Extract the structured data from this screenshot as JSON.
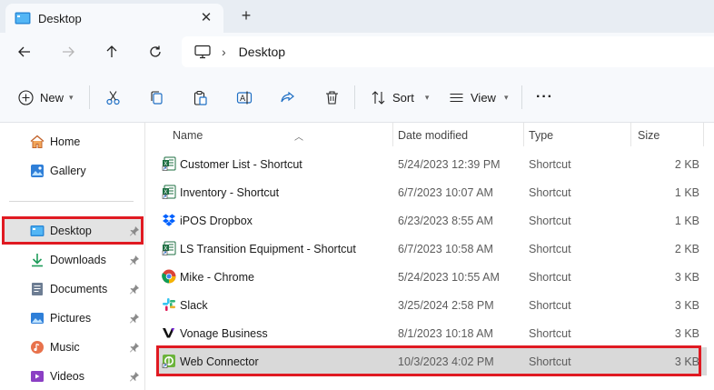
{
  "tab": {
    "title": "Desktop",
    "close_glyph": "✕",
    "new_glyph": "+"
  },
  "address": {
    "crumb": "Desktop",
    "separator": "›"
  },
  "toolbar": {
    "new_label": "New",
    "sort_label": "Sort",
    "view_label": "View",
    "more_glyph": "···"
  },
  "sidebar": {
    "items": [
      {
        "label": "Home",
        "icon": "home-icon"
      },
      {
        "label": "Gallery",
        "icon": "gallery-icon"
      },
      {
        "label": "Desktop",
        "icon": "desktop-icon",
        "pinned": true
      },
      {
        "label": "Downloads",
        "icon": "downloads-icon",
        "pinned": true
      },
      {
        "label": "Documents",
        "icon": "documents-icon",
        "pinned": true
      },
      {
        "label": "Pictures",
        "icon": "pictures-icon",
        "pinned": true
      },
      {
        "label": "Music",
        "icon": "music-icon",
        "pinned": true
      },
      {
        "label": "Videos",
        "icon": "videos-icon",
        "pinned": true
      }
    ]
  },
  "columns": {
    "name": "Name",
    "date": "Date modified",
    "type": "Type",
    "size": "Size"
  },
  "files": [
    {
      "name": "Customer List - Shortcut",
      "date": "5/24/2023 12:39 PM",
      "type": "Shortcut",
      "size": "2 KB",
      "icon": "excel-shortcut-icon"
    },
    {
      "name": "Inventory - Shortcut",
      "date": "6/7/2023 10:07 AM",
      "type": "Shortcut",
      "size": "1 KB",
      "icon": "excel-shortcut-icon"
    },
    {
      "name": "iPOS Dropbox",
      "date": "6/23/2023 8:55 AM",
      "type": "Shortcut",
      "size": "1 KB",
      "icon": "dropbox-icon"
    },
    {
      "name": "LS Transition Equipment - Shortcut",
      "date": "6/7/2023 10:58 AM",
      "type": "Shortcut",
      "size": "2 KB",
      "icon": "excel-shortcut-icon"
    },
    {
      "name": "Mike - Chrome",
      "date": "5/24/2023 10:55 AM",
      "type": "Shortcut",
      "size": "3 KB",
      "icon": "chrome-icon"
    },
    {
      "name": "Slack",
      "date": "3/25/2024 2:58 PM",
      "type": "Shortcut",
      "size": "3 KB",
      "icon": "slack-icon"
    },
    {
      "name": "Vonage Business",
      "date": "8/1/2023 10:18 AM",
      "type": "Shortcut",
      "size": "3 KB",
      "icon": "vonage-icon"
    },
    {
      "name": "Web Connector",
      "date": "10/3/2023 4:02 PM",
      "type": "Shortcut",
      "size": "3 KB",
      "icon": "web-connector-icon"
    }
  ],
  "colors": {
    "highlight": "#e01a22",
    "selected": "#d9d9d9",
    "excel_green": "#1d6f42",
    "dropbox_blue": "#0061fe"
  }
}
